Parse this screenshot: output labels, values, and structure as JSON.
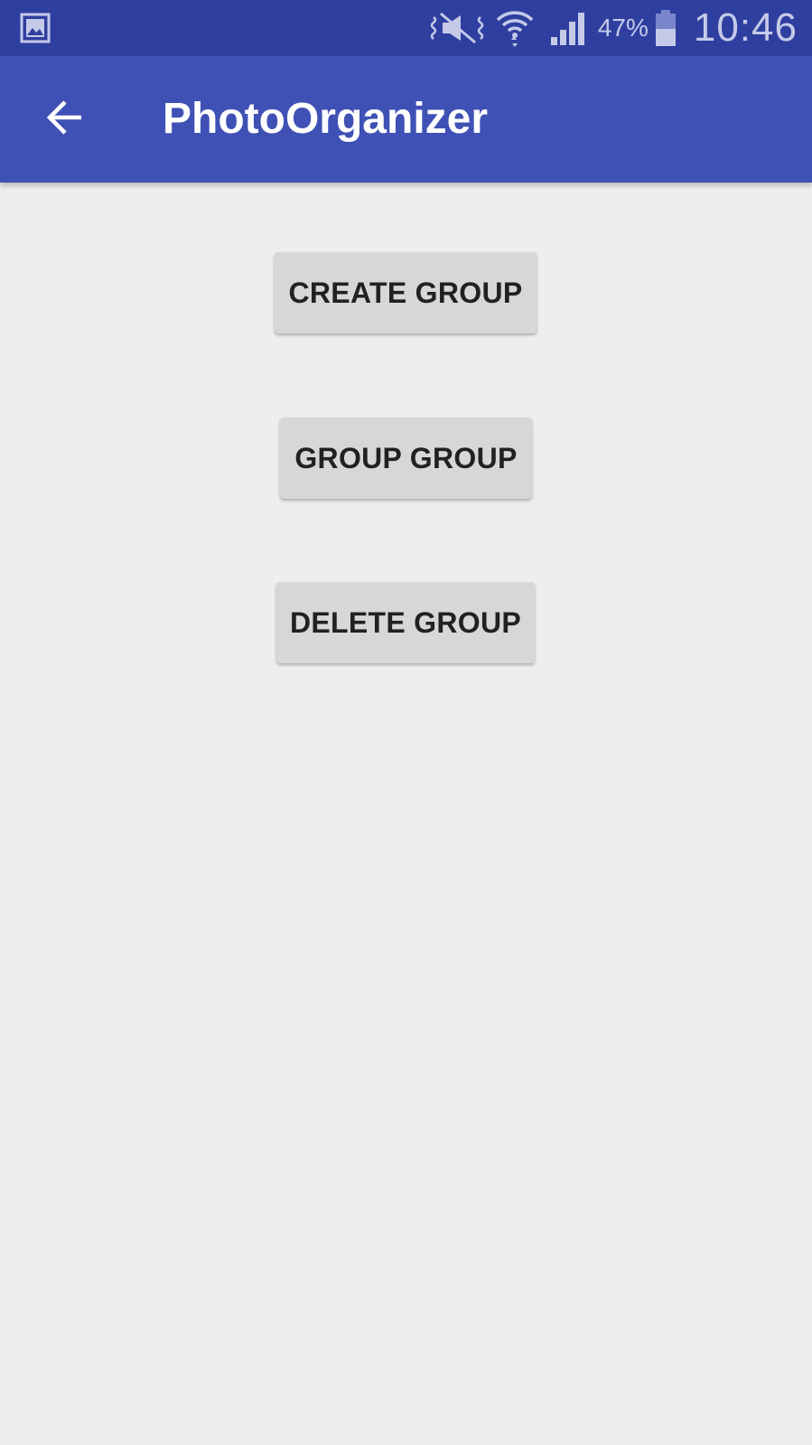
{
  "status_bar": {
    "left_icon": "gallery-icon",
    "icons": [
      "vibrate-mute-icon",
      "wifi-icon",
      "signal-icon",
      "battery-icon"
    ],
    "battery_percent": "47%",
    "time": "10:46"
  },
  "app_bar": {
    "back_icon": "arrow-back-icon",
    "title": "PhotoOrganizer"
  },
  "buttons": {
    "create_label": "CREATE GROUP",
    "group_label": "GROUP GROUP",
    "delete_label": "DELETE GROUP"
  },
  "colors": {
    "status_bar": "#2f3f9f",
    "app_bar": "#3f51b5",
    "background": "#eeeeee",
    "button": "#d6d7d7",
    "button_text": "#212121"
  }
}
